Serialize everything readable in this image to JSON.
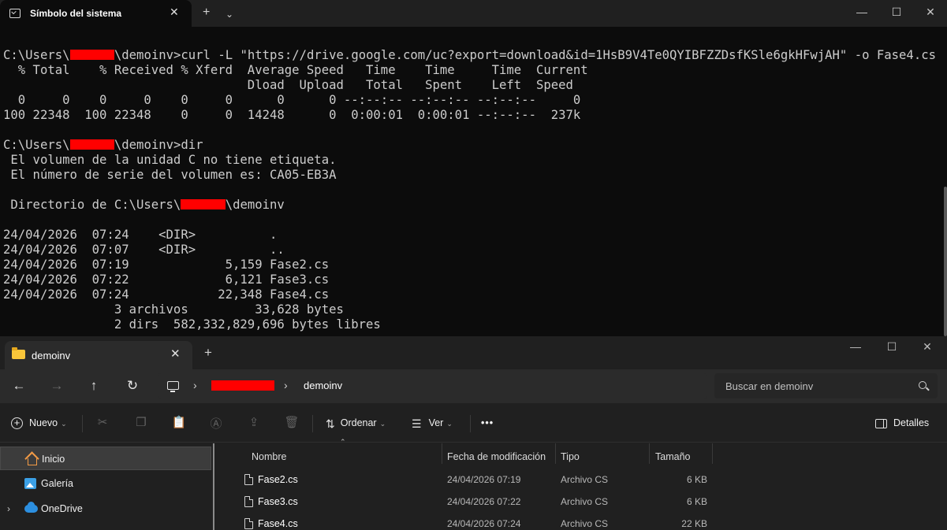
{
  "terminal": {
    "title": "Símbolo del sistema",
    "lines": [
      {
        "parts": [
          "C:\\Users\\",
          "#R6",
          "\\demoinv>curl -L \"https://drive.google.com/uc?export=download&id=1HsB9V4Te0QYIBFZZDsfKSle6gkHFwjAH\" -o Fase4.cs"
        ]
      },
      {
        "parts": [
          "  % Total    % Received % Xferd  Average Speed   Time    Time     Time  Current"
        ]
      },
      {
        "parts": [
          "                                 Dload  Upload   Total   Spent    Left  Speed"
        ]
      },
      {
        "parts": [
          "  0     0    0     0    0     0      0      0 --:--:-- --:--:-- --:--:--     0"
        ]
      },
      {
        "parts": [
          "100 22348  100 22348    0     0  14248      0  0:00:01  0:00:01 --:--:--  237k"
        ]
      },
      {
        "parts": [
          ""
        ]
      },
      {
        "parts": [
          "C:\\Users\\",
          "#R6",
          "\\demoinv>dir"
        ]
      },
      {
        "parts": [
          " El volumen de la unidad C no tiene etiqueta."
        ]
      },
      {
        "parts": [
          " El número de serie del volumen es: CA05-EB3A"
        ]
      },
      {
        "parts": [
          ""
        ]
      },
      {
        "parts": [
          " Directorio de C:\\Users\\",
          "#R6",
          "\\demoinv"
        ]
      },
      {
        "parts": [
          ""
        ]
      },
      {
        "parts": [
          "24/04/2026  07:24    <DIR>          ."
        ]
      },
      {
        "parts": [
          "24/04/2026  07:07    <DIR>          .."
        ]
      },
      {
        "parts": [
          "24/04/2026  07:19             5,159 Fase2.cs"
        ]
      },
      {
        "parts": [
          "24/04/2026  07:22             6,121 Fase3.cs"
        ]
      },
      {
        "parts": [
          "24/04/2026  07:24            22,348 Fase4.cs"
        ]
      },
      {
        "parts": [
          "               3 archivos         33,628 bytes"
        ]
      },
      {
        "parts": [
          "               2 dirs  582,332,829,696 bytes libres"
        ]
      }
    ]
  },
  "explorer": {
    "tab_title": "demoinv",
    "breadcrumb": "demoinv",
    "search_placeholder": "Buscar en demoinv",
    "toolbar": {
      "new_label": "Nuevo",
      "sort_label": "Ordenar",
      "view_label": "Ver",
      "more_label": "•••",
      "details_label": "Detalles"
    },
    "nav": [
      {
        "label": "Inicio",
        "icon": "home-icon",
        "selected": true
      },
      {
        "label": "Galería",
        "icon": "gallery-icon",
        "selected": false
      },
      {
        "label": "OneDrive",
        "icon": "onedrive-icon",
        "selected": false
      }
    ],
    "columns": [
      "Nombre",
      "Fecha de modificación",
      "Tipo",
      "Tamaño"
    ],
    "files": [
      {
        "name": "Fase2.cs",
        "date": "24/04/2026 07:19",
        "type": "Archivo CS",
        "size": "6 KB"
      },
      {
        "name": "Fase3.cs",
        "date": "24/04/2026 07:22",
        "type": "Archivo CS",
        "size": "6 KB"
      },
      {
        "name": "Fase4.cs",
        "date": "24/04/2026 07:24",
        "type": "Archivo CS",
        "size": "22 KB"
      }
    ]
  },
  "colors": {
    "redaction": "#ff0000",
    "terminal_bg": "#0c0c0c",
    "terminal_text": "#cccccc",
    "explorer_bg": "#202020"
  }
}
